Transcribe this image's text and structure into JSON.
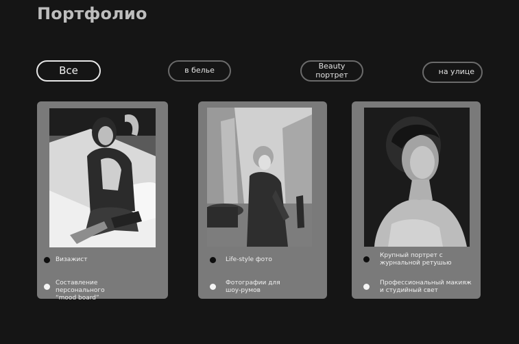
{
  "page": {
    "title": "Портфолио"
  },
  "filters": [
    {
      "label": "Все",
      "active": true
    },
    {
      "label": "в белье",
      "active": false
    },
    {
      "label": "Beauty\nпортрет",
      "active": false
    },
    {
      "label": "на улице",
      "active": false
    }
  ],
  "cards": [
    {
      "photo_icon": "bedroom-portrait-photo",
      "features": [
        {
          "marker": "black",
          "text": "Визажист"
        },
        {
          "marker": "white",
          "text": "Составление персонального\n“mood board”"
        }
      ]
    },
    {
      "photo_icon": "street-portrait-photo",
      "features": [
        {
          "marker": "black",
          "text": "Life-style фото"
        },
        {
          "marker": "white",
          "text": "Фотографии для\nшоу-румов"
        }
      ]
    },
    {
      "photo_icon": "beauty-portrait-photo",
      "features": [
        {
          "marker": "black",
          "text": "Крупный портрет с\nжурнальной ретушью"
        },
        {
          "marker": "white",
          "text": "Профессиональный макияж\nи студийный свет"
        }
      ]
    }
  ],
  "colors": {
    "background": "#151515",
    "card": "#7a7a7a",
    "chip_border": "#6b6b6b",
    "chip_active_border": "#e8e8e8"
  }
}
